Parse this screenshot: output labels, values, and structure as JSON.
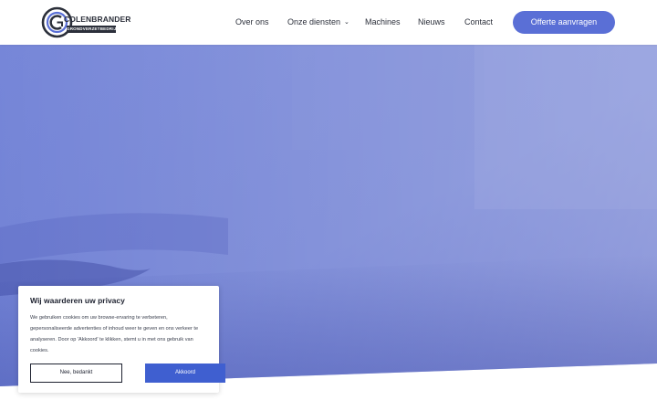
{
  "brand": {
    "name": "COLENBRANDER",
    "subtitle": "GRONDVERZETBEDRIJF",
    "logo_icon": "cg-logo-icon",
    "color_dark": "#2b2f3a",
    "color_blue": "#5a6fd6"
  },
  "nav": {
    "items": [
      {
        "label": "Over ons"
      },
      {
        "label": "Onze diensten",
        "icon": "chevron-down-icon",
        "chevron": "⌄"
      },
      {
        "label": "Machines"
      },
      {
        "label": "Nieuws"
      },
      {
        "label": "Contact"
      }
    ],
    "cta_label": "Offerte aanvragen"
  },
  "hero": {
    "overlay_color": "#5668c9"
  },
  "cookie": {
    "title": "Wij waarderen uw privacy",
    "text": "We gebruiken cookies om uw browse-ervaring te verbeteren, gepersonaliseerde advertenties of inhoud weer te geven en ons verkeer te analyseren. Door op 'Akkoord' te klikken, stemt u in met ons gebruik van cookies.",
    "decline_label": "Nee, bedankt",
    "accept_label": "Akkoord",
    "accept_color": "#3f5fd0"
  }
}
